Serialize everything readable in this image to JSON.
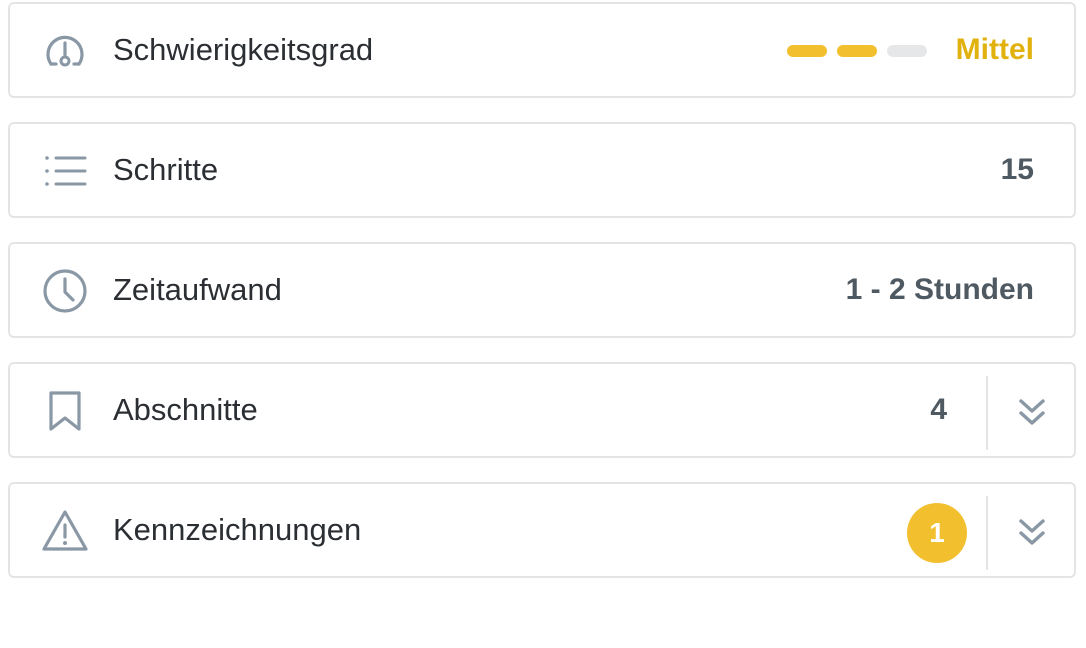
{
  "colors": {
    "accent": "#f2bf2f",
    "accent_text": "#e1b10d",
    "icon": "#8a98a6",
    "border": "#e2e4e6",
    "value_text": "#4e5962",
    "bar_empty": "#e6e7e8"
  },
  "rows": {
    "difficulty": {
      "icon": "gauge-icon",
      "label": "Schwierigkeitsgrad",
      "level_filled": 2,
      "level_total": 3,
      "value": "Mittel"
    },
    "steps": {
      "icon": "list-icon",
      "label": "Schritte",
      "value": "15"
    },
    "time": {
      "icon": "clock-icon",
      "label": "Zeitaufwand",
      "value": "1 - 2 Stunden"
    },
    "sections": {
      "icon": "bookmark-icon",
      "label": "Abschnitte",
      "value": "4",
      "toggle_icon": "chevron-double-down-icon"
    },
    "flags": {
      "icon": "warning-icon",
      "label": "Kennzeichnungen",
      "badge": "1",
      "toggle_icon": "chevron-double-down-icon"
    }
  }
}
